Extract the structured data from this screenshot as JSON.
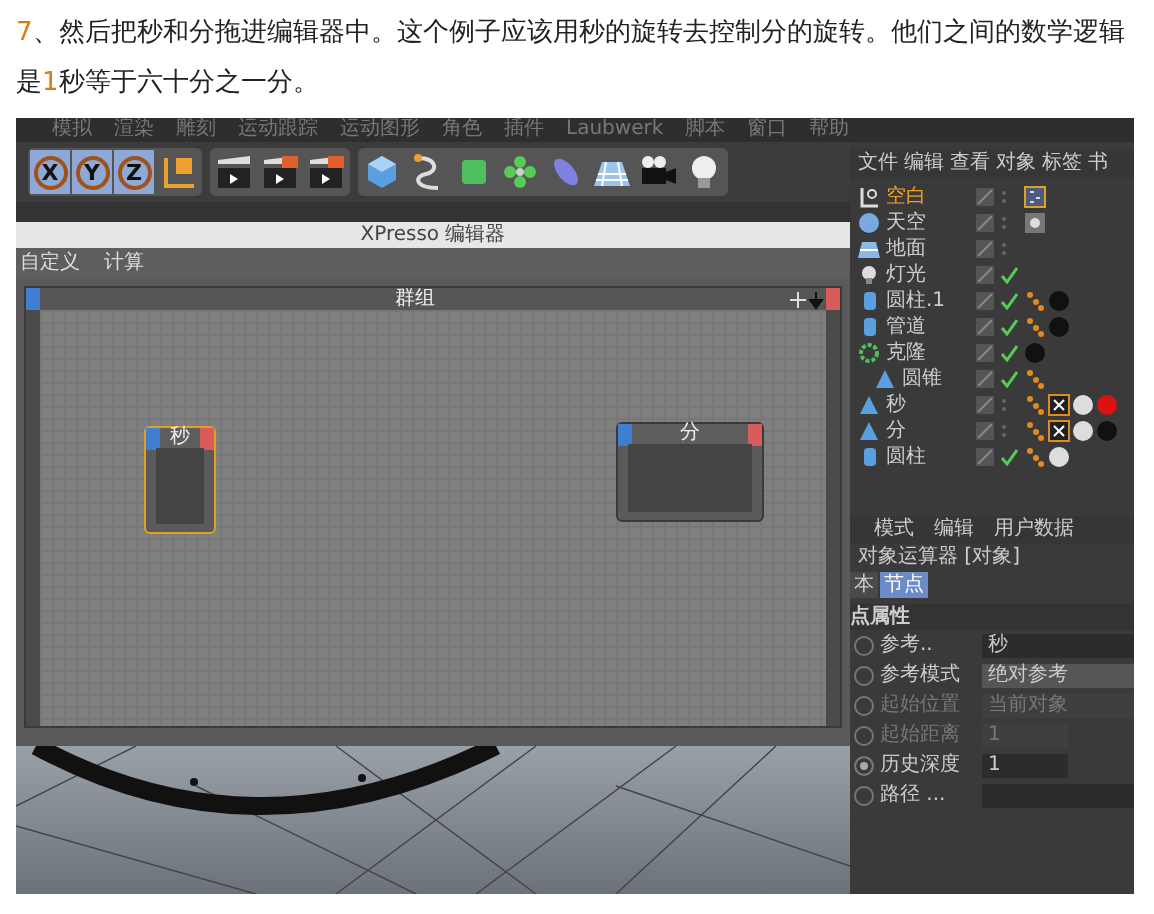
{
  "paragraph": [
    {
      "text": "7",
      "highlight": true
    },
    {
      "text": "、然后把秒和分拖进编辑器中。这个例子应该用秒的旋转去控制分的旋转。他们之间的数学逻辑是",
      "highlight": false
    },
    {
      "text": "1",
      "highlight": true
    },
    {
      "text": "秒等于六十分之一分。",
      "highlight": false
    }
  ],
  "screenshot": {
    "menu": [
      "模拟",
      "渲染",
      "雕刻",
      "运动跟踪",
      "运动图形",
      "角色",
      "插件",
      "Laubwerk",
      "脚本",
      "窗口",
      "帮助"
    ],
    "toolbar": {
      "axis_buttons": [
        {
          "label": "X",
          "selected": true
        },
        {
          "label": "Y",
          "selected": true
        },
        {
          "label": "Z",
          "selected": true
        }
      ]
    },
    "xpresso": {
      "title": "XPresso 编辑器",
      "menu": [
        "自定义",
        "计算"
      ],
      "group_title": "群组",
      "nodes": [
        {
          "title": "秒",
          "selected": true,
          "kind": "tall"
        },
        {
          "title": "分",
          "selected": false,
          "kind": "wide"
        }
      ]
    },
    "objects": {
      "menu": [
        "文件",
        "编辑",
        "查看",
        "对象",
        "标签",
        "书"
      ],
      "items": [
        {
          "name": "空白",
          "kind": "null",
          "selected": true,
          "checked": false,
          "tags": [
            {
              "kind": "xpresso"
            }
          ]
        },
        {
          "name": "天空",
          "kind": "sky",
          "selected": false,
          "checked": false,
          "tags": [
            {
              "kind": "texture"
            }
          ]
        },
        {
          "name": "地面",
          "kind": "floor",
          "selected": false,
          "checked": false
        },
        {
          "name": "灯光",
          "kind": "light",
          "selected": false,
          "checked": true
        },
        {
          "name": "圆柱.1",
          "kind": "cylinder",
          "selected": false,
          "checked": true,
          "tags": [
            {
              "kind": "dots"
            },
            {
              "kind": "sphere",
              "color": "#111111"
            }
          ]
        },
        {
          "name": "管道",
          "kind": "cylinder",
          "selected": false,
          "checked": true,
          "tags": [
            {
              "kind": "dots"
            },
            {
              "kind": "sphere",
              "color": "#111111"
            }
          ]
        },
        {
          "name": "克隆",
          "kind": "cloner",
          "selected": false,
          "checked": true,
          "tags": [
            {
              "kind": "sphere",
              "color": "#111111"
            }
          ],
          "children": [
            {
              "name": "圆锥",
              "kind": "cone",
              "selected": false,
              "checked": true,
              "tags": [
                {
                  "kind": "dots"
                }
              ]
            }
          ]
        },
        {
          "name": "秒",
          "kind": "cone",
          "selected": false,
          "checked": false,
          "tags": [
            {
              "kind": "dots"
            },
            {
              "kind": "target"
            },
            {
              "kind": "sphere",
              "color": "#dddddd"
            },
            {
              "kind": "sphere",
              "color": "#dd1111"
            }
          ]
        },
        {
          "name": "分",
          "kind": "cone",
          "selected": false,
          "checked": false,
          "tags": [
            {
              "kind": "dots"
            },
            {
              "kind": "target"
            },
            {
              "kind": "sphere",
              "color": "#dddddd"
            },
            {
              "kind": "sphere",
              "color": "#111111"
            }
          ]
        },
        {
          "name": "圆柱",
          "kind": "cylinder",
          "selected": false,
          "checked": true,
          "tags": [
            {
              "kind": "dots"
            },
            {
              "kind": "sphere",
              "color": "#dddddd"
            }
          ]
        }
      ]
    },
    "attributes": {
      "menu": [
        "模式",
        "编辑",
        "用户数据"
      ],
      "title": "对象运算器 [对象]",
      "tabs": [
        {
          "label": "本",
          "selected": false
        },
        {
          "label": "节点",
          "selected": true
        }
      ],
      "section": "点属性",
      "fields": [
        {
          "label": "参考..",
          "value": "秒",
          "disabled": false,
          "checked": false,
          "kind": "link"
        },
        {
          "label": "参考模式",
          "value": "绝对参考",
          "disabled": false,
          "checked": false,
          "kind": "dropdown"
        },
        {
          "label": "起始位置",
          "value": "当前对象",
          "disabled": true,
          "checked": false,
          "kind": "dropdown"
        },
        {
          "label": "起始距离",
          "value": "1",
          "disabled": true,
          "checked": false,
          "kind": "number"
        },
        {
          "label": "历史深度",
          "value": "1",
          "disabled": false,
          "checked": true,
          "kind": "number"
        },
        {
          "label": "路径 ...",
          "disabled": false,
          "checked": false,
          "kind": "link"
        }
      ]
    }
  }
}
